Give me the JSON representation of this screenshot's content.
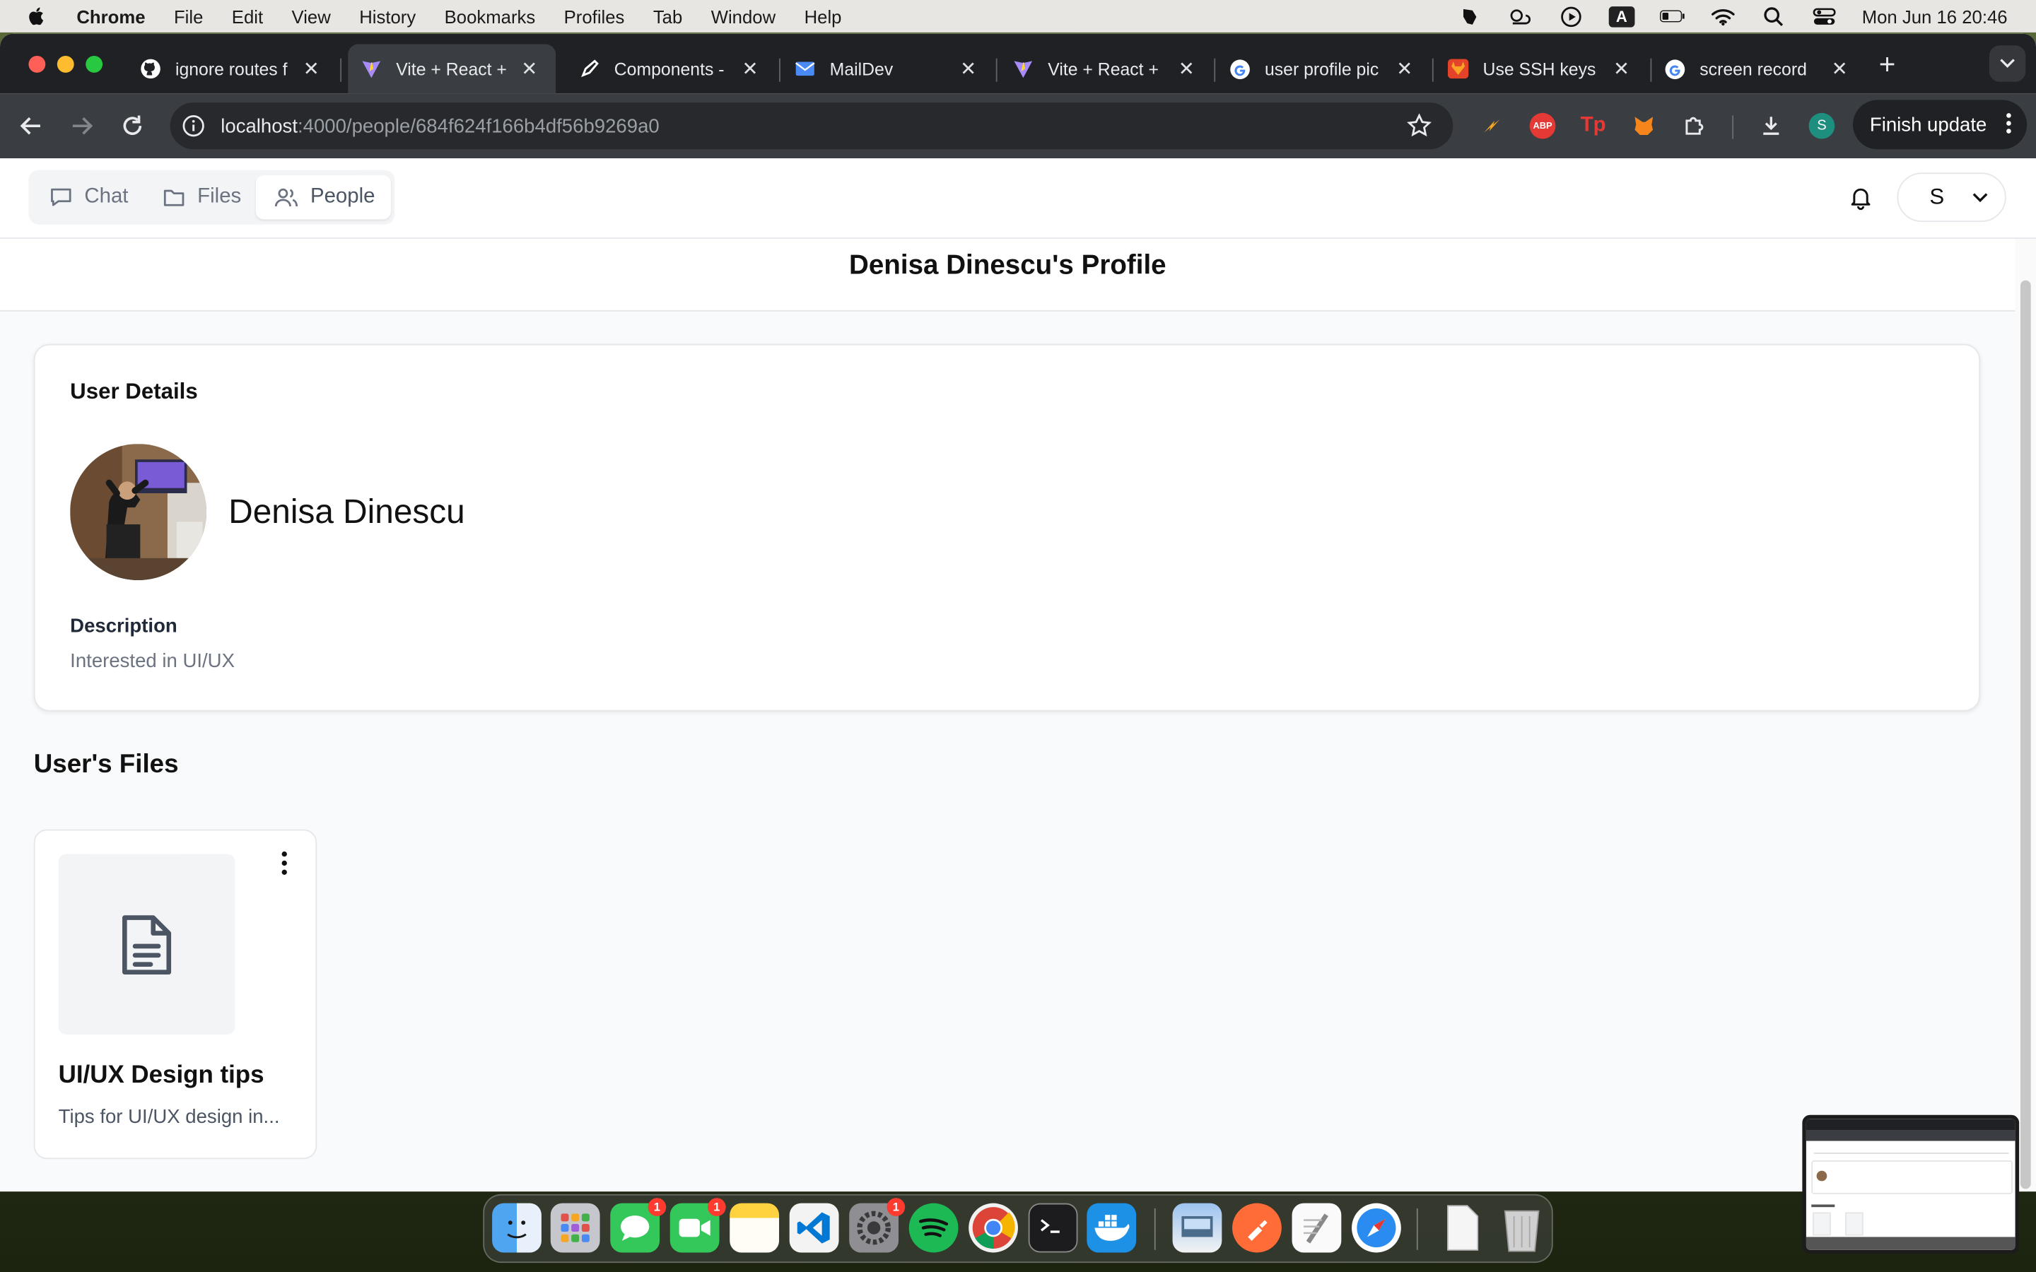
{
  "menubar": {
    "app": "Chrome",
    "items": [
      "File",
      "Edit",
      "View",
      "History",
      "Bookmarks",
      "Profiles",
      "Tab",
      "Window",
      "Help"
    ],
    "clock": "Mon Jun 16  20:46",
    "input_source": "A"
  },
  "tabs": [
    {
      "title": "ignore routes f",
      "icon": "github-icon",
      "active": false
    },
    {
      "title": "Vite + React +",
      "icon": "vite-icon",
      "active": true
    },
    {
      "title": "Components -",
      "icon": "pen-icon",
      "active": false
    },
    {
      "title": "MailDev",
      "icon": "mail-icon",
      "active": false
    },
    {
      "title": "Vite + React +",
      "icon": "vite-icon",
      "active": false
    },
    {
      "title": "user profile pic",
      "icon": "google-icon",
      "active": false
    },
    {
      "title": "Use SSH keys",
      "icon": "gitlab-icon",
      "active": false
    },
    {
      "title": "screen record",
      "icon": "google-icon",
      "active": false
    }
  ],
  "toolbar": {
    "url_host": "localhost",
    "url_path": ":4000/people/684f624f166b4df56b9269a0",
    "finish_update": "Finish update",
    "profile_initial": "S",
    "ext_abp": "ABP",
    "ext_tp": "Tp"
  },
  "app_nav": [
    {
      "label": "Chat",
      "icon": "chat-icon"
    },
    {
      "label": "Files",
      "icon": "folder-icon"
    },
    {
      "label": "People",
      "icon": "people-icon"
    }
  ],
  "user_menu": {
    "initial": "S"
  },
  "page": {
    "title": "Denisa Dinescu's Profile",
    "details_heading": "User Details",
    "user_name": "Denisa Dinescu",
    "description_label": "Description",
    "description_value": "Interested in UI/UX",
    "files_heading": "User's Files"
  },
  "files": [
    {
      "name": "UI/UX Design tips",
      "description": "Tips for UI/UX design in..."
    }
  ],
  "dock": {
    "apps": [
      "Finder",
      "Launchpad",
      "Messages",
      "FaceTime",
      "Notes",
      "VS Code",
      "System Settings",
      "Spotify",
      "Chrome",
      "Terminal",
      "Docker",
      "Preview",
      "Postman",
      "TextEdit",
      "Safari",
      "Documents",
      "Trash"
    ],
    "badge_messages": "1",
    "badge_facetime": "1",
    "badge_settings": "1"
  }
}
